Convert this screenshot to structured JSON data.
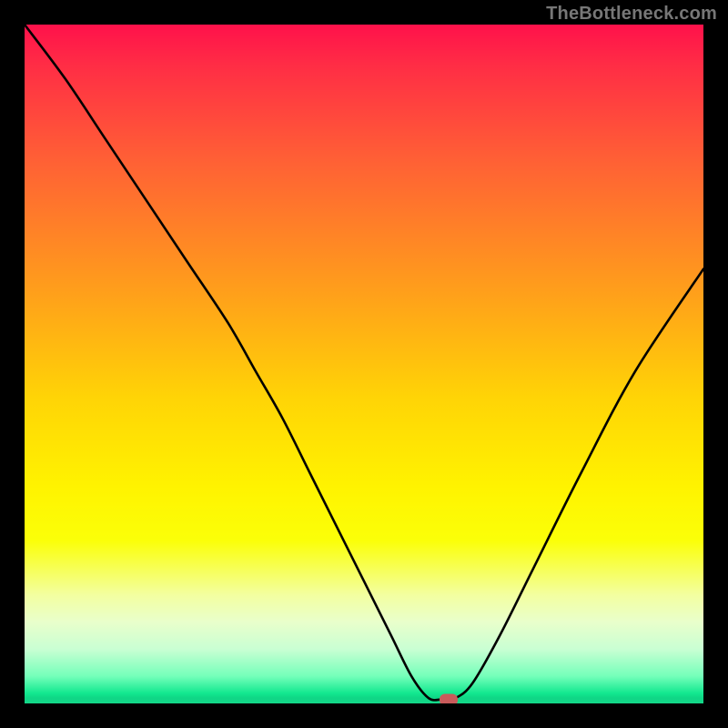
{
  "watermark": "TheBottleneck.com",
  "chart_data": {
    "type": "line",
    "title": "",
    "xlabel": "",
    "ylabel": "",
    "xlim": [
      0,
      100
    ],
    "ylim": [
      0,
      100
    ],
    "grid": false,
    "legend": false,
    "series": [
      {
        "name": "bottleneck-curve",
        "x": [
          0,
          6,
          12,
          18,
          24,
          30,
          34,
          38,
          42,
          46,
          50,
          54,
          57,
          59.5,
          61.5,
          63.5,
          66,
          70,
          75,
          82,
          90,
          100
        ],
        "values": [
          100,
          92,
          83,
          74,
          65,
          56,
          49,
          42,
          34,
          26,
          18,
          10,
          4,
          0.8,
          0.6,
          0.8,
          3,
          10,
          20,
          34,
          49,
          64
        ]
      }
    ],
    "marker": {
      "x": 62.5,
      "y": 0.6
    },
    "background_gradient": {
      "orientation": "vertical",
      "stops": [
        {
          "pos": 0.0,
          "color": "#ff114b"
        },
        {
          "pos": 0.2,
          "color": "#ff6035"
        },
        {
          "pos": 0.4,
          "color": "#ffa11a"
        },
        {
          "pos": 0.55,
          "color": "#ffd406"
        },
        {
          "pos": 0.68,
          "color": "#fff300"
        },
        {
          "pos": 0.84,
          "color": "#f3ffa0"
        },
        {
          "pos": 0.92,
          "color": "#c9ffd3"
        },
        {
          "pos": 0.98,
          "color": "#12e88f"
        },
        {
          "pos": 1.0,
          "color": "#14d888"
        }
      ]
    }
  }
}
